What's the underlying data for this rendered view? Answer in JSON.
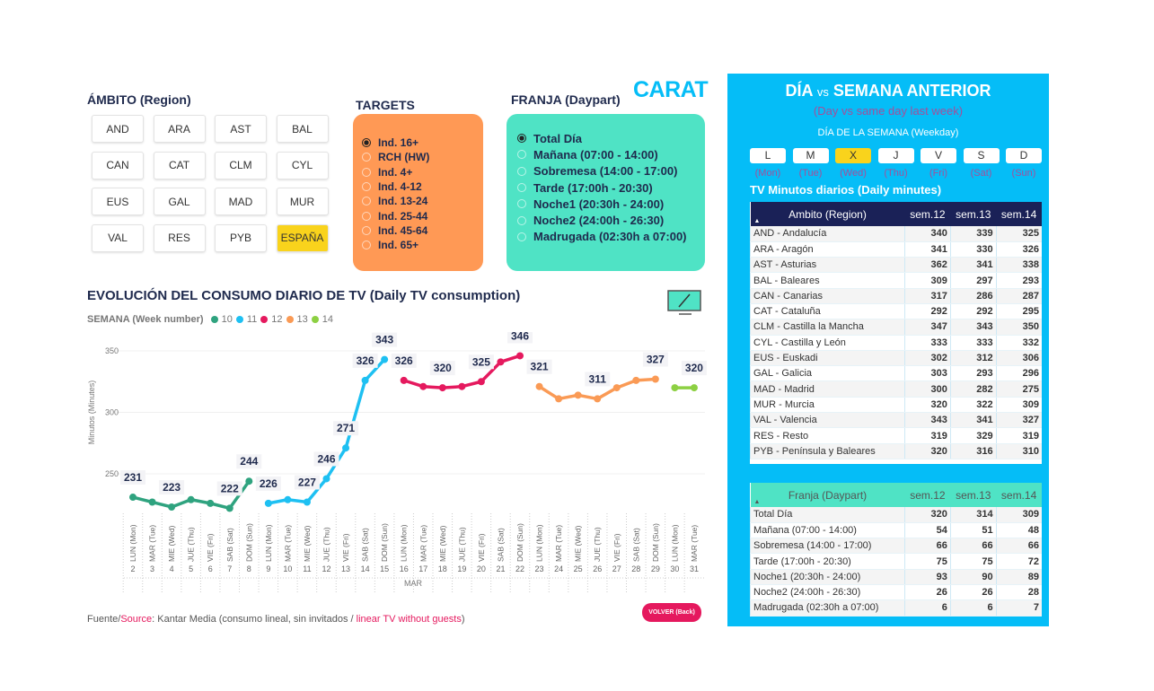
{
  "region": {
    "title": "ÁMBITO (Region)",
    "buttons": [
      "AND",
      "ARA",
      "AST",
      "BAL",
      "CAN",
      "CAT",
      "CLM",
      "CYL",
      "EUS",
      "GAL",
      "MAD",
      "MUR",
      "VAL",
      "RES",
      "PYB",
      "ESPAÑA"
    ],
    "selected": "ESPAÑA"
  },
  "targets": {
    "title": "TARGETS",
    "items": [
      "Ind. 16+",
      "RCH (HW)",
      "Ind. 4+",
      "Ind. 4-12",
      "Ind. 13-24",
      "Ind. 25-44",
      "Ind. 45-64",
      "Ind. 65+"
    ],
    "selected": 0,
    "color": "#ff9955"
  },
  "franja": {
    "title": "FRANJA (Daypart)",
    "items": [
      "Total Día",
      "Mañana (07:00 - 14:00)",
      "Sobremesa (14:00 - 17:00)",
      "Tarde (17:00h - 20:30)",
      "Noche1 (20:30h - 24:00)",
      "Noche2 (24:00h - 26:30)",
      "Madrugada (02:30h a 07:00)"
    ],
    "selected": 0,
    "color": "#4fe3c5"
  },
  "logo": "CARAT",
  "chart": {
    "title": "EVOLUCIÓN DEL CONSUMO DIARIO DE TV (Daily TV consumption)",
    "legend_title": "SEMANA (Week number)",
    "ylabel": "Minutos (Minutes)",
    "month": "MAR"
  },
  "chart_data": {
    "type": "line",
    "ylim": [
      215,
      355
    ],
    "yticks": [
      250,
      300,
      350
    ],
    "grid": true,
    "legend_placement": "top-left",
    "ylabel": "Minutos (Minutes)",
    "xlabel": "MAR",
    "weekdays": [
      "LUN (Mon)",
      "MAR (Tue)",
      "MIE (Wed)",
      "JUE (Thu)",
      "VIE (Fri)",
      "SAB (Sat)",
      "DOM (Sun)"
    ],
    "series": [
      {
        "name": "10",
        "color": "#2fa37f",
        "days": [
          2,
          3,
          4,
          5,
          6,
          7,
          8
        ],
        "values": [
          231,
          227,
          223,
          229,
          226,
          222,
          244
        ],
        "labeled": [
          true,
          false,
          true,
          false,
          false,
          true,
          true
        ]
      },
      {
        "name": "11",
        "color": "#1ec0f2",
        "days": [
          9,
          10,
          11,
          12,
          13,
          14,
          15
        ],
        "values": [
          226,
          229,
          227,
          246,
          271,
          326,
          343
        ],
        "labeled": [
          true,
          false,
          true,
          true,
          true,
          true,
          true
        ]
      },
      {
        "name": "12",
        "color": "#e5195e",
        "days": [
          16,
          17,
          18,
          19,
          20,
          21,
          22
        ],
        "values": [
          326,
          321,
          320,
          321,
          325,
          341,
          346
        ],
        "labeled": [
          true,
          false,
          true,
          false,
          true,
          false,
          true
        ]
      },
      {
        "name": "13",
        "color": "#fa9a55",
        "days": [
          23,
          24,
          25,
          26,
          27,
          28,
          29
        ],
        "values": [
          321,
          311,
          314,
          311,
          320,
          326,
          327
        ],
        "labeled": [
          true,
          false,
          false,
          true,
          false,
          false,
          true
        ]
      },
      {
        "name": "14",
        "color": "#8dd043",
        "days": [
          30,
          31
        ],
        "values": [
          320,
          320
        ],
        "labeled": [
          false,
          true
        ]
      }
    ]
  },
  "source": {
    "prefix": "Fuente/",
    "source_word": "Source",
    "mid": ": Kantar Media (consumo lineal, sin invitados / ",
    "en": "linear TV without guests",
    ")": ")"
  },
  "back_button": "VOLVER (Back)",
  "right": {
    "title_a": "DÍA",
    "title_vs": "vs",
    "title_b": "SEMANA ANTERIOR",
    "subtitle": "(Day vs same day last week)",
    "weekday_title": "DÍA DE LA SEMANA (Weekday)",
    "days": [
      {
        "l": "L",
        "en": "(Mon)"
      },
      {
        "l": "M",
        "en": "(Tue)"
      },
      {
        "l": "X",
        "en": "(Wed)"
      },
      {
        "l": "J",
        "en": "(Thu)"
      },
      {
        "l": "V",
        "en": "(Fri)"
      },
      {
        "l": "S",
        "en": "(Sat)"
      },
      {
        "l": "D",
        "en": "(Sun)"
      }
    ],
    "selected_day": "X",
    "table_title": "TV Minutos diarios (Daily minutes)",
    "region_table": {
      "headers": [
        "Ambito (Region)",
        "sem.12",
        "sem.13",
        "sem.14"
      ],
      "rows": [
        [
          "AND - Andalucía",
          "340",
          "339",
          "325"
        ],
        [
          "ARA - Aragón",
          "341",
          "330",
          "326"
        ],
        [
          "AST - Asturias",
          "362",
          "341",
          "338"
        ],
        [
          "BAL - Baleares",
          "309",
          "297",
          "293"
        ],
        [
          "CAN - Canarias",
          "317",
          "286",
          "287"
        ],
        [
          "CAT - Cataluña",
          "292",
          "292",
          "295"
        ],
        [
          "CLM - Castilla la Mancha",
          "347",
          "343",
          "350"
        ],
        [
          "CYL - Castilla y León",
          "333",
          "333",
          "332"
        ],
        [
          "EUS - Euskadi",
          "302",
          "312",
          "306"
        ],
        [
          "GAL - Galicia",
          "303",
          "293",
          "296"
        ],
        [
          "MAD - Madrid",
          "300",
          "282",
          "275"
        ],
        [
          "MUR - Murcia",
          "320",
          "322",
          "309"
        ],
        [
          "VAL - Valencia",
          "343",
          "341",
          "327"
        ],
        [
          "RES - Resto",
          "319",
          "329",
          "319"
        ],
        [
          "PYB - Península y Baleares",
          "320",
          "316",
          "310"
        ]
      ]
    },
    "franja_table": {
      "headers": [
        "Franja (Daypart)",
        "sem.12",
        "sem.13",
        "sem.14"
      ],
      "rows": [
        [
          "Total Día",
          "320",
          "314",
          "309"
        ],
        [
          "Mañana (07:00 - 14:00)",
          "54",
          "51",
          "48"
        ],
        [
          "Sobremesa (14:00 - 17:00)",
          "66",
          "66",
          "66"
        ],
        [
          "Tarde (17:00h - 20:30)",
          "75",
          "75",
          "72"
        ],
        [
          "Noche1 (20:30h - 24:00)",
          "93",
          "90",
          "89"
        ],
        [
          "Noche2 (24:00h - 26:30)",
          "26",
          "26",
          "28"
        ],
        [
          "Madrugada (02:30h a 07:00)",
          "6",
          "6",
          "7"
        ]
      ]
    }
  }
}
